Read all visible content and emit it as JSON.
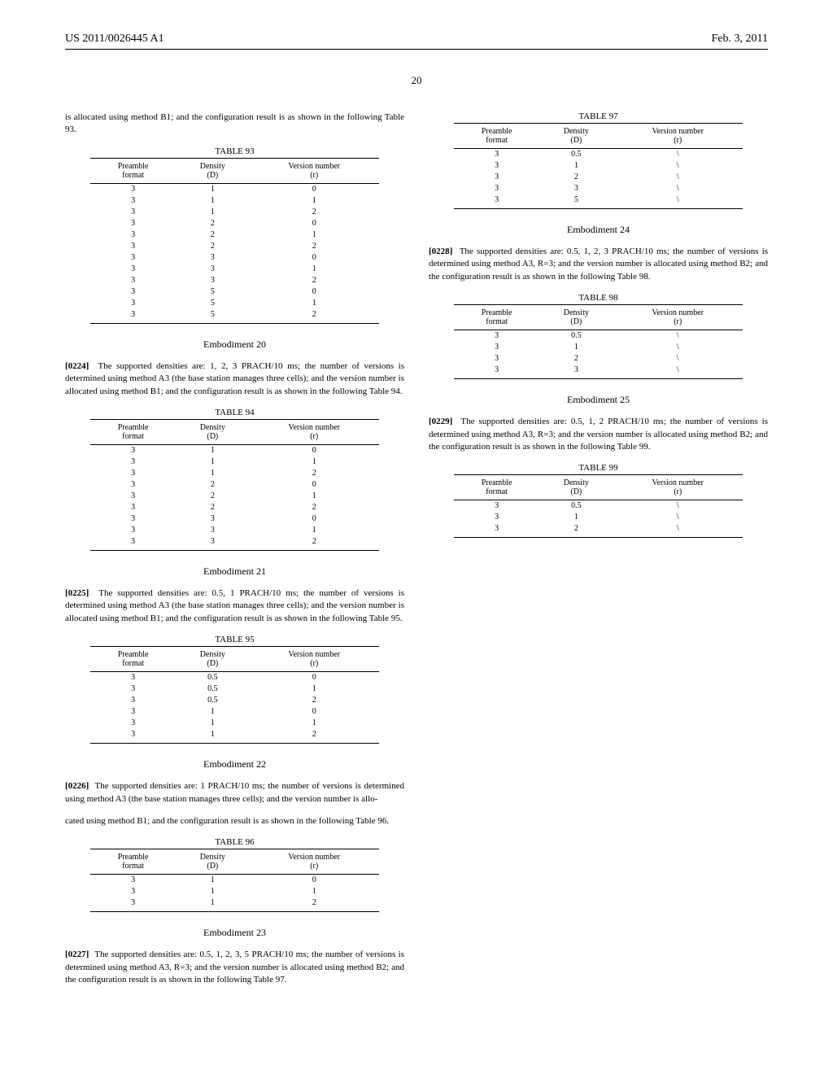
{
  "header": {
    "pub_number": "US 2011/0026445 A1",
    "date": "Feb. 3, 2011",
    "page": "20"
  },
  "left": {
    "intro_p1": "is allocated using method B1; and the configuration result is as shown in the following Table 93.",
    "table93": {
      "title": "TABLE 93",
      "headers": [
        "Preamble format",
        "Density (D)",
        "Version number (r)"
      ],
      "rows": [
        [
          "3",
          "1",
          "0"
        ],
        [
          "3",
          "1",
          "1"
        ],
        [
          "3",
          "1",
          "2"
        ],
        [
          "3",
          "2",
          "0"
        ],
        [
          "3",
          "2",
          "1"
        ],
        [
          "3",
          "2",
          "2"
        ],
        [
          "3",
          "3",
          "0"
        ],
        [
          "3",
          "3",
          "1"
        ],
        [
          "3",
          "3",
          "2"
        ],
        [
          "3",
          "5",
          "0"
        ],
        [
          "3",
          "5",
          "1"
        ],
        [
          "3",
          "5",
          "2"
        ]
      ]
    },
    "emb20": {
      "title": "Embodiment 20",
      "num": "[0224]",
      "text": "The supported densities are: 1, 2, 3 PRACH/10 ms; the number of versions is determined using method A3 (the base station manages three cells); and the version number is allocated using method B1; and the configuration result is as shown in the following Table 94."
    },
    "table94": {
      "title": "TABLE 94",
      "headers": [
        "Preamble format",
        "Density (D)",
        "Version number (r)"
      ],
      "rows": [
        [
          "3",
          "1",
          "0"
        ],
        [
          "3",
          "1",
          "1"
        ],
        [
          "3",
          "1",
          "2"
        ],
        [
          "3",
          "2",
          "0"
        ],
        [
          "3",
          "2",
          "1"
        ],
        [
          "3",
          "2",
          "2"
        ],
        [
          "3",
          "3",
          "0"
        ],
        [
          "3",
          "3",
          "1"
        ],
        [
          "3",
          "3",
          "2"
        ]
      ]
    },
    "emb21": {
      "title": "Embodiment 21",
      "num": "[0225]",
      "text": "The supported densities are: 0.5, 1 PRACH/10 ms; the number of versions is determined using method A3 (the base station manages three cells); and the version number is allocated using method B1; and the configuration result is as shown in the following Table 95."
    },
    "table95": {
      "title": "TABLE 95",
      "headers": [
        "Preamble format",
        "Density (D)",
        "Version number (r)"
      ],
      "rows": [
        [
          "3",
          "0.5",
          "0"
        ],
        [
          "3",
          "0.5",
          "1"
        ],
        [
          "3",
          "0.5",
          "2"
        ],
        [
          "3",
          "1",
          "0"
        ],
        [
          "3",
          "1",
          "1"
        ],
        [
          "3",
          "1",
          "2"
        ]
      ]
    },
    "emb22": {
      "title": "Embodiment 22",
      "num": "[0226]",
      "text": "The supported densities are: 1 PRACH/10 ms; the number of versions is determined using method A3 (the base station manages three cells); and the version number is allo-"
    }
  },
  "right": {
    "intro_p1": "cated using method B1; and the configuration result is as shown in the following Table 96.",
    "table96": {
      "title": "TABLE 96",
      "headers": [
        "Preamble format",
        "Density (D)",
        "Version number (r)"
      ],
      "rows": [
        [
          "3",
          "1",
          "0"
        ],
        [
          "3",
          "1",
          "1"
        ],
        [
          "3",
          "1",
          "2"
        ]
      ]
    },
    "emb23": {
      "title": "Embodiment 23",
      "num": "[0227]",
      "text": "The supported densities are: 0.5, 1, 2, 3, 5 PRACH/10 ms; the number of versions is determined using method A3, R=3; and the version number is allocated using method B2; and the configuration result is as shown in the following Table 97."
    },
    "table97": {
      "title": "TABLE 97",
      "headers": [
        "Preamble format",
        "Density (D)",
        "Version number (r)"
      ],
      "rows": [
        [
          "3",
          "0.5",
          "\\"
        ],
        [
          "3",
          "1",
          "\\"
        ],
        [
          "3",
          "2",
          "\\"
        ],
        [
          "3",
          "3",
          "\\"
        ],
        [
          "3",
          "5",
          "\\"
        ]
      ]
    },
    "emb24": {
      "title": "Embodiment 24",
      "num": "[0228]",
      "text": "The supported densities are: 0.5, 1, 2, 3 PRACH/10 ms; the number of versions is determined using method A3, R=3; and the version number is allocated using method B2; and the configuration result is as shown in the following Table 98."
    },
    "table98": {
      "title": "TABLE 98",
      "headers": [
        "Preamble format",
        "Density (D)",
        "Version number (r)"
      ],
      "rows": [
        [
          "3",
          "0.5",
          "\\"
        ],
        [
          "3",
          "1",
          "\\"
        ],
        [
          "3",
          "2",
          "\\"
        ],
        [
          "3",
          "3",
          "\\"
        ]
      ]
    },
    "emb25": {
      "title": "Embodiment 25",
      "num": "[0229]",
      "text": "The supported densities are: 0.5, 1, 2 PRACH/10 ms; the number of versions is determined using method A3, R=3; and the version number is allocated using method B2; and the configuration result is as shown in the following Table 99."
    },
    "table99": {
      "title": "TABLE 99",
      "headers": [
        "Preamble format",
        "Density (D)",
        "Version number (r)"
      ],
      "rows": [
        [
          "3",
          "0.5",
          "\\"
        ],
        [
          "3",
          "1",
          "\\"
        ],
        [
          "3",
          "2",
          "\\"
        ]
      ]
    }
  }
}
